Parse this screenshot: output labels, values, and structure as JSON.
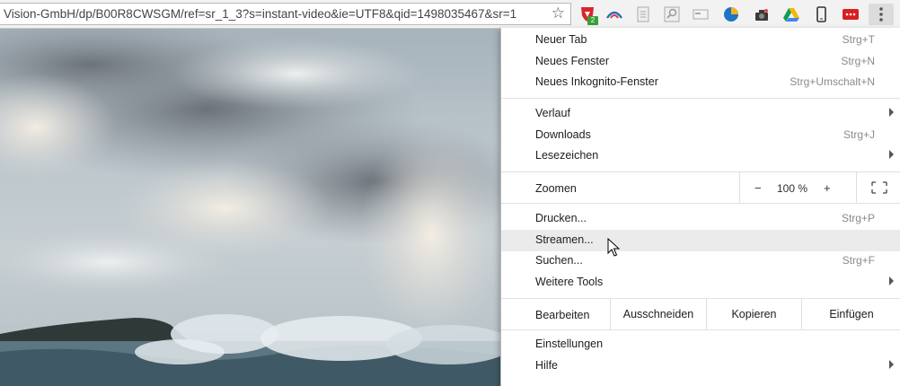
{
  "toolbar": {
    "url": "Vision-GmbH/dp/B00R8CWSGM/ref=sr_1_3?s=instant-video&ie=UTF8&qid=1498035467&sr=1",
    "extensions": [
      {
        "icon": "shield-extension-icon",
        "badge": "2"
      },
      {
        "icon": "arc-extension-icon"
      },
      {
        "icon": "page-extension-icon"
      },
      {
        "icon": "search-page-extension-icon"
      },
      {
        "icon": "card-extension-icon"
      },
      {
        "icon": "circle-extension-icon"
      },
      {
        "icon": "camera-extension-icon"
      },
      {
        "icon": "drive-icon"
      },
      {
        "icon": "phone-icon"
      },
      {
        "icon": "red-extension-icon"
      }
    ],
    "menu_icon": "kebab-menu-icon"
  },
  "menu": {
    "items": [
      {
        "label": "Neuer Tab",
        "shortcut": "Strg+T"
      },
      {
        "label": "Neues Fenster",
        "shortcut": "Strg+N"
      },
      {
        "label": "Neues Inkognito-Fenster",
        "shortcut": "Strg+Umschalt+N"
      },
      {
        "label": "Verlauf",
        "shortcut": ""
      },
      {
        "label": "Downloads",
        "shortcut": "Strg+J"
      },
      {
        "label": "Lesezeichen",
        "shortcut": ""
      },
      {
        "label": "Drucken...",
        "shortcut": "Strg+P"
      },
      {
        "label": "Streamen...",
        "shortcut": ""
      },
      {
        "label": "Suchen...",
        "shortcut": "Strg+F"
      },
      {
        "label": "Weitere Tools",
        "shortcut": ""
      },
      {
        "label": "Einstellungen",
        "shortcut": ""
      },
      {
        "label": "Hilfe",
        "shortcut": ""
      }
    ],
    "zoom": {
      "label": "Zoomen",
      "minus": "−",
      "value": "100 %",
      "plus": "+"
    },
    "edit": {
      "label": "Bearbeiten",
      "cut": "Ausschneiden",
      "copy": "Kopieren",
      "paste": "Einfügen"
    },
    "hovered_item": "Streamen..."
  }
}
